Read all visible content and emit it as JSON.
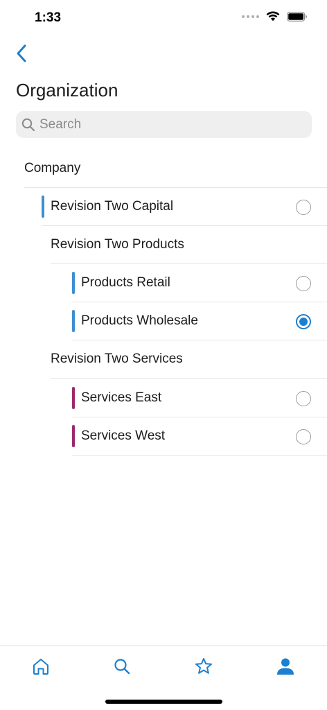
{
  "status_bar": {
    "time": "1:33"
  },
  "nav": {
    "title": "Organization"
  },
  "search": {
    "placeholder": "Search",
    "value": ""
  },
  "list": {
    "items": [
      {
        "label": "Company",
        "type": "header",
        "selected": false,
        "color": ""
      },
      {
        "label": "Revision Two Capital",
        "type": "selectable",
        "selected": false,
        "color": "#3d8fd1"
      },
      {
        "label": "Revision Two Products",
        "type": "header",
        "selected": false,
        "color": ""
      },
      {
        "label": "Products Retail",
        "type": "selectable",
        "selected": false,
        "color": "#3d8fd1"
      },
      {
        "label": "Products Wholesale",
        "type": "selectable",
        "selected": true,
        "color": "#3d8fd1"
      },
      {
        "label": "Revision Two Services",
        "type": "header",
        "selected": false,
        "color": ""
      },
      {
        "label": "Services East",
        "type": "selectable",
        "selected": false,
        "color": "#9c2a6b"
      },
      {
        "label": "Services West",
        "type": "selectable",
        "selected": false,
        "color": "#9c2a6b"
      }
    ]
  },
  "tab_bar": {
    "tabs": [
      {
        "icon": "home-icon",
        "active": false
      },
      {
        "icon": "search-icon",
        "active": false
      },
      {
        "icon": "star-icon",
        "active": false
      },
      {
        "icon": "person-icon",
        "active": true
      }
    ]
  },
  "colors": {
    "accent": "#1c7fd0",
    "capital_tag": "#3d8fd1",
    "services_tag": "#9c2a6b"
  }
}
